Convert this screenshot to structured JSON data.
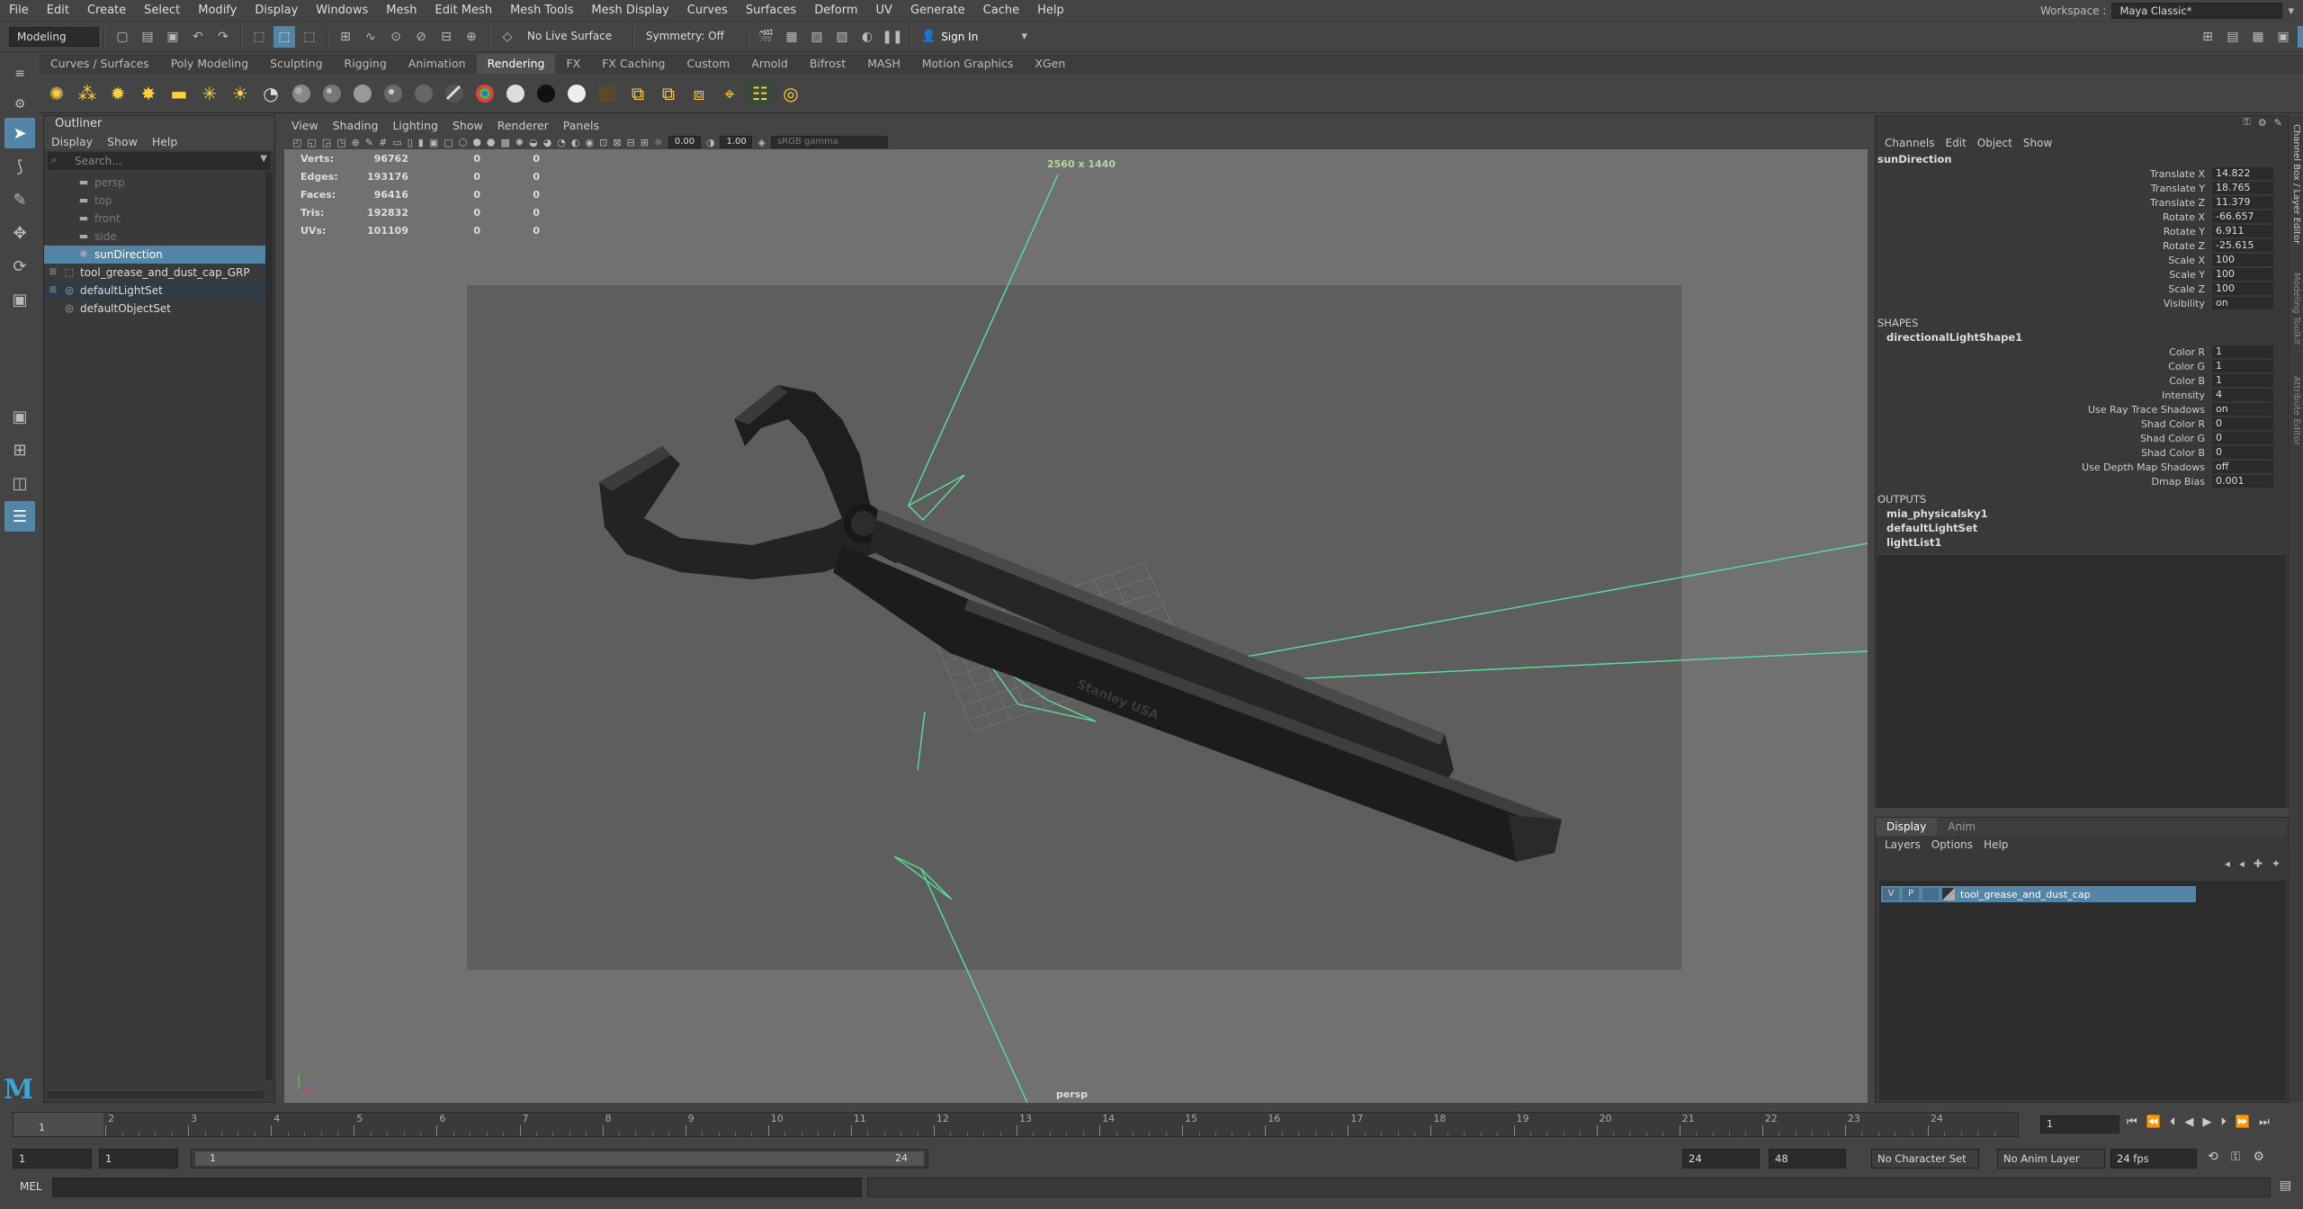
{
  "menubar": {
    "items": [
      "File",
      "Edit",
      "Create",
      "Select",
      "Modify",
      "Display",
      "Windows",
      "Mesh",
      "Edit Mesh",
      "Mesh Tools",
      "Mesh Display",
      "Curves",
      "Surfaces",
      "Deform",
      "UV",
      "Generate",
      "Cache",
      "Help"
    ],
    "workspace_label": "Workspace :",
    "workspace_value": "Maya Classic*"
  },
  "statusline": {
    "mode": "Modeling",
    "live_surface": "No Live Surface",
    "symmetry": "Symmetry: Off",
    "sign_in": "Sign In"
  },
  "shelf": {
    "tabs": [
      "Curves / Surfaces",
      "Poly Modeling",
      "Sculpting",
      "Rigging",
      "Animation",
      "Rendering",
      "FX",
      "FX Caching",
      "Custom",
      "Arnold",
      "Bifrost",
      "MASH",
      "Motion Graphics",
      "XGen"
    ],
    "active_tab": "Rendering"
  },
  "outliner": {
    "title": "Outliner",
    "menus": [
      "Display",
      "Show",
      "Help"
    ],
    "search_placeholder": "Search...",
    "items": [
      {
        "label": "persp",
        "state": "dim",
        "icon": "camera-icon"
      },
      {
        "label": "top",
        "state": "dim",
        "icon": "camera-icon"
      },
      {
        "label": "front",
        "state": "dim",
        "icon": "camera-icon"
      },
      {
        "label": "side",
        "state": "dim",
        "icon": "camera-icon"
      },
      {
        "label": "sunDirection",
        "state": "selected",
        "icon": "light-icon"
      },
      {
        "label": "tool_grease_and_dust_cap_GRP",
        "state": "normal",
        "icon": "group-icon"
      },
      {
        "label": "defaultLightSet",
        "state": "highlight",
        "icon": "set-icon"
      },
      {
        "label": "defaultObjectSet",
        "state": "normal",
        "icon": "set-icon"
      }
    ]
  },
  "viewport": {
    "menus": [
      "View",
      "Shading",
      "Lighting",
      "Show",
      "Renderer",
      "Panels"
    ],
    "field_a": "0.00",
    "field_b": "1.00",
    "color_space": "sRGB gamma",
    "resolution": "2560 x 1440",
    "camera": "persp",
    "hud": [
      {
        "label": "Verts:",
        "v1": "96762",
        "v2": "0",
        "v3": "0"
      },
      {
        "label": "Edges:",
        "v1": "193176",
        "v2": "0",
        "v3": "0"
      },
      {
        "label": "Faces:",
        "v1": "96416",
        "v2": "0",
        "v3": "0"
      },
      {
        "label": "Tris:",
        "v1": "192832",
        "v2": "0",
        "v3": "0"
      },
      {
        "label": "UVs:",
        "v1": "101109",
        "v2": "0",
        "v3": "0"
      }
    ],
    "engraving": "Stanley USA"
  },
  "channelbox": {
    "menus": [
      "Channels",
      "Edit",
      "Object",
      "Show"
    ],
    "node": "sunDirection",
    "channels": [
      {
        "label": "Translate X",
        "value": "14.822"
      },
      {
        "label": "Translate Y",
        "value": "18.765"
      },
      {
        "label": "Translate Z",
        "value": "11.379"
      },
      {
        "label": "Rotate X",
        "value": "-66.657"
      },
      {
        "label": "Rotate Y",
        "value": "6.911"
      },
      {
        "label": "Rotate Z",
        "value": "-25.615"
      },
      {
        "label": "Scale X",
        "value": "100"
      },
      {
        "label": "Scale Y",
        "value": "100"
      },
      {
        "label": "Scale Z",
        "value": "100"
      },
      {
        "label": "Visibility",
        "value": "on"
      }
    ],
    "shapes_header": "SHAPES",
    "shape_node": "directionalLightShape1",
    "shape_channels": [
      {
        "label": "Color R",
        "value": "1"
      },
      {
        "label": "Color G",
        "value": "1"
      },
      {
        "label": "Color B",
        "value": "1"
      },
      {
        "label": "Intensity",
        "value": "4"
      },
      {
        "label": "Use Ray Trace Shadows",
        "value": "on"
      },
      {
        "label": "Shad Color R",
        "value": "0"
      },
      {
        "label": "Shad Color G",
        "value": "0"
      },
      {
        "label": "Shad Color B",
        "value": "0"
      },
      {
        "label": "Use Depth Map Shadows",
        "value": "off"
      },
      {
        "label": "Dmap Bias",
        "value": "0.001"
      }
    ],
    "outputs_header": "OUTPUTS",
    "outputs": [
      "mia_physicalsky1",
      "defaultLightSet",
      "lightList1"
    ]
  },
  "layer_editor": {
    "tabs": [
      "Display",
      "Anim"
    ],
    "menus": [
      "Layers",
      "Options",
      "Help"
    ],
    "layer": {
      "v": "V",
      "p": "P",
      "name": "tool_grease_and_dust_cap"
    }
  },
  "right_strip": {
    "labels": [
      "Channel Box / Layer Editor",
      "Modeling Toolkit",
      "Attribute Editor"
    ]
  },
  "timeline": {
    "labels": [
      "1",
      "2",
      "3",
      "4",
      "5",
      "6",
      "7",
      "8",
      "9",
      "10",
      "11",
      "12",
      "13",
      "14",
      "15",
      "16",
      "17",
      "18",
      "19",
      "20",
      "21",
      "22",
      "23",
      "24"
    ],
    "current_frame": "1",
    "current_frame_label": "1"
  },
  "range": {
    "start": "1",
    "start2": "1",
    "slider_start": "1",
    "slider_end": "24",
    "end": "24",
    "end2": "48",
    "character_set": "No Character Set",
    "anim_layer": "No Anim Layer",
    "fps": "24 fps"
  },
  "cmdline": {
    "label": "MEL"
  },
  "colors": {
    "accent": "#5285a6",
    "light_gizmo": "#58e09a",
    "active_frame": "#5285a6"
  }
}
